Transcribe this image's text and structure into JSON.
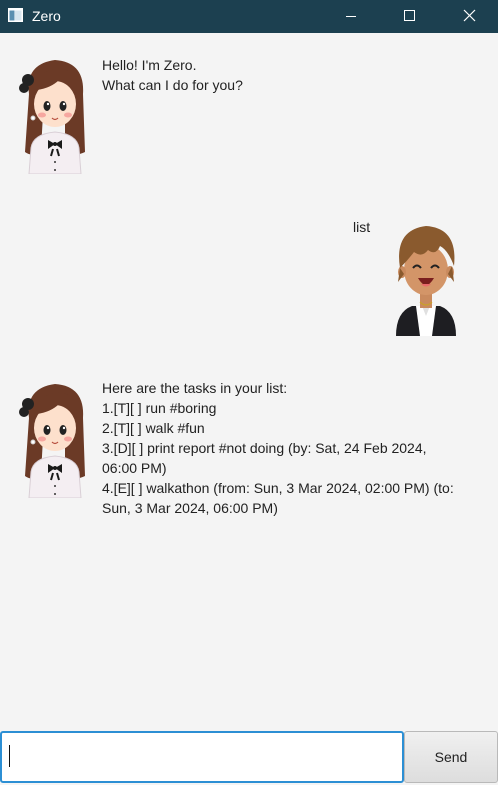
{
  "window": {
    "title": "Zero",
    "icon": "app-window-icon",
    "controls": [
      "minimize-icon",
      "maximize-icon",
      "close-icon"
    ]
  },
  "colors": {
    "titlebar": "#1c4050",
    "background": "#f4f4f4",
    "input_border": "#2c8fd4"
  },
  "messages": [
    {
      "sender": "Zero",
      "avatar": "girl-avatar",
      "lines": [
        "Hello! I'm Zero.",
        "What can I do for you?"
      ]
    },
    {
      "sender": "user",
      "avatar": "boy-avatar",
      "lines": [
        "list"
      ]
    },
    {
      "sender": "Zero",
      "avatar": "girl-avatar",
      "lines": [
        "Here are the tasks in your list:",
        "1.[T][ ] run #boring",
        "2.[T][ ] walk #fun",
        "3.[D][ ] print report #not doing (by: Sat, 24 Feb 2024,",
        "06:00 PM)",
        "4.[E][ ] walkathon (from: Sun, 3 Mar 2024, 02:00 PM) (to:",
        "Sun, 3 Mar 2024, 06:00 PM)"
      ]
    }
  ],
  "input": {
    "value": "",
    "placeholder": ""
  },
  "send_button": {
    "label": "Send"
  }
}
